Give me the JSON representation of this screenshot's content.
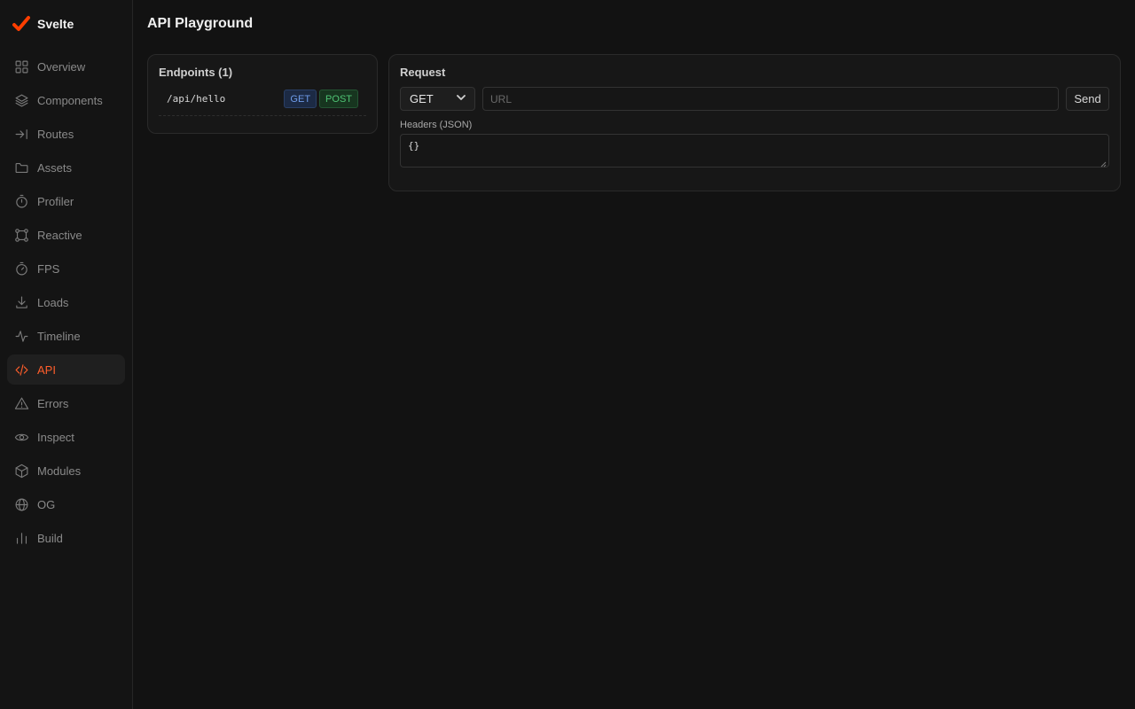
{
  "app": {
    "name": "Svelte",
    "accent": "#ff5e2b"
  },
  "sidebar": {
    "items": [
      {
        "label": "Overview",
        "icon": "grid-icon"
      },
      {
        "label": "Components",
        "icon": "layers-icon"
      },
      {
        "label": "Routes",
        "icon": "arrow-right-to-line-icon"
      },
      {
        "label": "Assets",
        "icon": "folder-icon"
      },
      {
        "label": "Profiler",
        "icon": "stopwatch-icon"
      },
      {
        "label": "Reactive",
        "icon": "graph-nodes-icon"
      },
      {
        "label": "FPS",
        "icon": "timer-icon"
      },
      {
        "label": "Loads",
        "icon": "download-icon"
      },
      {
        "label": "Timeline",
        "icon": "activity-icon"
      },
      {
        "label": "API",
        "icon": "code-icon",
        "active": true
      },
      {
        "label": "Errors",
        "icon": "warning-triangle-icon"
      },
      {
        "label": "Inspect",
        "icon": "eye-icon"
      },
      {
        "label": "Modules",
        "icon": "box-icon"
      },
      {
        "label": "OG",
        "icon": "globe-icon"
      },
      {
        "label": "Build",
        "icon": "bar-chart-icon"
      }
    ]
  },
  "main": {
    "title": "API Playground",
    "endpoints": {
      "title": "Endpoints (1)",
      "items": [
        {
          "path": "/api/hello",
          "methods": [
            "GET",
            "POST"
          ]
        }
      ]
    },
    "request": {
      "title": "Request",
      "method": "GET",
      "url_placeholder": "URL",
      "send_label": "Send",
      "headers_label": "Headers (JSON)",
      "headers_value": "{}"
    }
  }
}
